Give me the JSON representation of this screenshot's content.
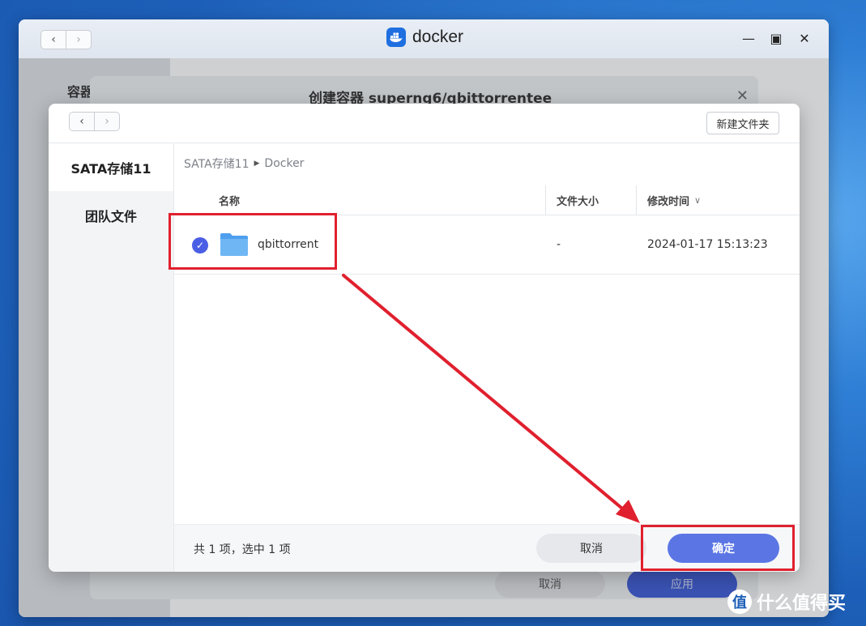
{
  "window": {
    "title": "docker",
    "back_icon": "‹",
    "forward_icon": "›",
    "minimize_icon": "—",
    "maximize_icon": "▣",
    "close_icon": "✕"
  },
  "background": {
    "sidebar_label": "容器",
    "dialog_title": "创建容器 superng6/qbittorrentee",
    "close_icon": "✕",
    "cancel_label": "取消",
    "apply_label": "应用"
  },
  "picker": {
    "new_folder_label": "新建文件夹",
    "sidebar": [
      {
        "label": "SATA存储11",
        "active": true
      },
      {
        "label": "团队文件",
        "active": false
      }
    ],
    "breadcrumb": [
      "SATA存储11",
      "Docker"
    ],
    "columns": {
      "name": "名称",
      "size": "文件大小",
      "modified": "修改时间",
      "sort_icon": "∨"
    },
    "rows": [
      {
        "name": "qbittorrent",
        "size": "-",
        "modified": "2024-01-17 15:13:23",
        "selected": true
      }
    ],
    "status": "共 1 项，选中 1 项",
    "cancel_label": "取消",
    "ok_label": "确定",
    "check_icon": "✓"
  },
  "watermark": {
    "logo": "值",
    "text": "什么值得买"
  },
  "colors": {
    "accent": "#5b76e4",
    "annotation": "#e0202e",
    "folder": "#5aaaf2"
  }
}
